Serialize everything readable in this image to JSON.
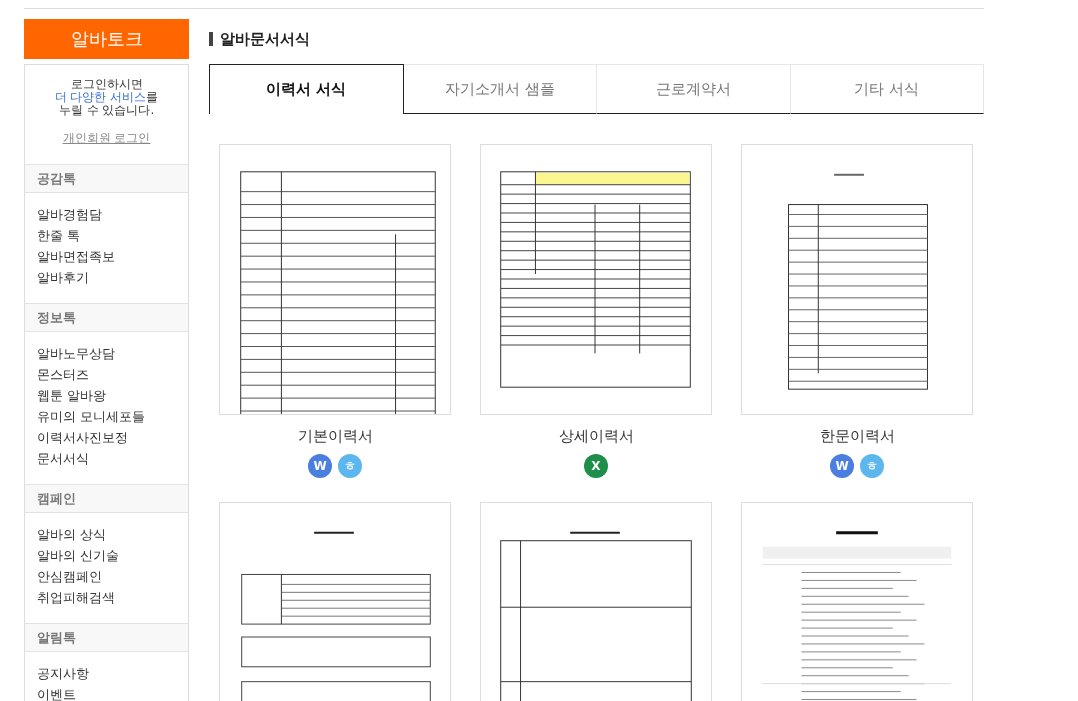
{
  "sidebar": {
    "brand": "알바토크",
    "login": {
      "line1": "로그인하시면",
      "link": "더 다양한 서비스",
      "link_suffix": "를",
      "line3": "누릴 수 있습니다.",
      "button": "개인회원 로그인"
    },
    "sections": [
      {
        "title": "공감톡",
        "items": [
          "알바경험담",
          "한줄 톡",
          "알바면접족보",
          "알바후기"
        ]
      },
      {
        "title": "정보톡",
        "items": [
          "알바노무상담",
          "몬스터즈",
          "웹툰 알바왕",
          "유미의 모니세포들",
          "이력서사진보정",
          "문서서식"
        ]
      },
      {
        "title": "캠페인",
        "items": [
          "알바의 상식",
          "알바의 신기술",
          "안심캠페인",
          "취업피해검색"
        ]
      },
      {
        "title": "알림톡",
        "items": [
          "공지사항",
          "이벤트"
        ]
      }
    ]
  },
  "page_title": "알바문서서식",
  "tabs": [
    {
      "label": "이력서 서식",
      "selected": true
    },
    {
      "label": "자기소개서 샘플",
      "selected": false
    },
    {
      "label": "근로계약서",
      "selected": false
    },
    {
      "label": "기타 서식",
      "selected": false
    }
  ],
  "cards": [
    {
      "kind": "picture",
      "title": "기본이력서",
      "formats": [
        {
          "kind": "word",
          "label": "W"
        },
        {
          "kind": "hwp",
          "label": "ㅎ"
        }
      ]
    },
    {
      "kind": "picture",
      "title": "상세이력서",
      "formats": [
        {
          "kind": "excel",
          "label": "X"
        }
      ]
    },
    {
      "kind": "picture",
      "title": "한문이력서",
      "formats": [
        {
          "kind": "word",
          "label": "W"
        },
        {
          "kind": "hwp",
          "label": "ㅎ"
        }
      ]
    },
    {
      "kind": "picture"
    },
    {
      "kind": "picture"
    },
    {
      "kind": "picture"
    }
  ]
}
